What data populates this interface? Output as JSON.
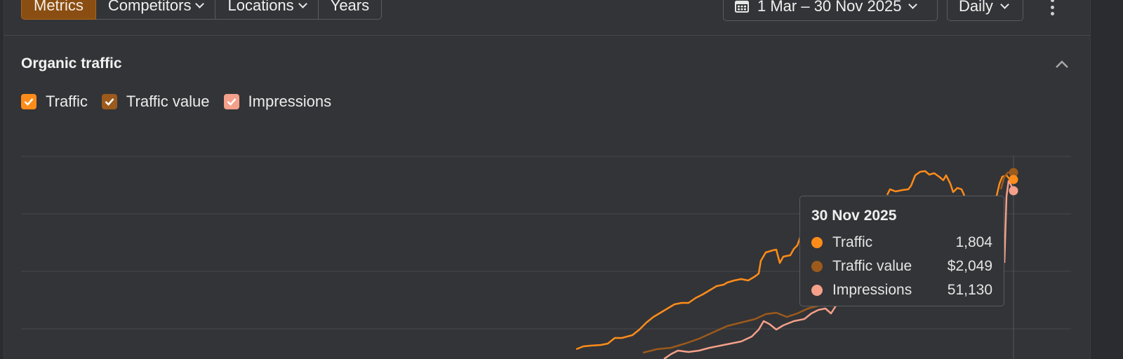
{
  "toolbar": {
    "tabs": [
      {
        "label": "Metrics",
        "active": true
      },
      {
        "label": "Competitors",
        "has_dropdown": true
      },
      {
        "label": "Locations",
        "has_dropdown": true
      },
      {
        "label": "Years"
      }
    ],
    "date_range": "1 Mar – 30 Nov 2025",
    "granularity": "Daily",
    "more_icon": "vertical-dots-icon"
  },
  "card": {
    "title": "Organic traffic",
    "collapse_icon": "chevron-up-icon"
  },
  "legend": [
    {
      "label": "Traffic",
      "color": "#ff8c1a",
      "checked": true
    },
    {
      "label": "Traffic value",
      "color": "#9c5a1c",
      "checked": true
    },
    {
      "label": "Impressions",
      "color": "#f4a08a",
      "checked": true
    }
  ],
  "tooltip": {
    "date": "30 Nov 2025",
    "rows": [
      {
        "label": "Traffic",
        "value": "1,804",
        "color": "#ff8c1a"
      },
      {
        "label": "Traffic value",
        "value": "$2,049",
        "color": "#9c5a1c"
      },
      {
        "label": "Impressions",
        "value": "51,130",
        "color": "#f4a08a"
      }
    ]
  },
  "chart_data": {
    "type": "line",
    "x_range": [
      "1 Mar 2025",
      "30 Nov 2025"
    ],
    "grid": true,
    "series": [
      {
        "name": "Traffic",
        "color": "#ff8c1a"
      },
      {
        "name": "Traffic value",
        "color": "#9c5a1c"
      },
      {
        "name": "Impressions",
        "color": "#f4a08a"
      }
    ]
  }
}
